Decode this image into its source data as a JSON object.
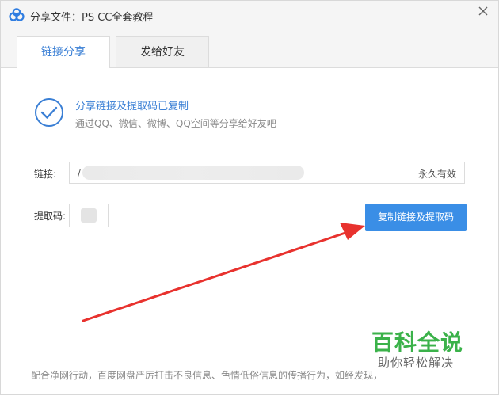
{
  "window": {
    "title": "分享文件：PS CC全套教程"
  },
  "tabs": [
    {
      "label": "链接分享",
      "active": true
    },
    {
      "label": "发给好友",
      "active": false
    }
  ],
  "success": {
    "title": "分享链接及提取码已复制",
    "subtitle": "通过QQ、微信、微博、QQ空间等分享给好友吧"
  },
  "link": {
    "label": "链接:",
    "value": "/",
    "validity": "永久有效"
  },
  "code": {
    "label": "提取码:"
  },
  "copy_button": {
    "label": "复制链接及提取码"
  },
  "footer": {
    "notice": "配合净网行动，百度网盘严厉打击不良信息、色情低俗信息的传播行为，如经发现，"
  },
  "watermark": {
    "main": "百科全说",
    "sub": "助你轻松解决"
  },
  "colors": {
    "accent": "#3a7fd5",
    "button": "#3a8ee6",
    "arrow": "#e8322e",
    "watermark": "#3bb24a"
  },
  "icons": {
    "app": "baidu-netdisk-logo",
    "close": "close-icon",
    "success": "check-circle-icon"
  }
}
